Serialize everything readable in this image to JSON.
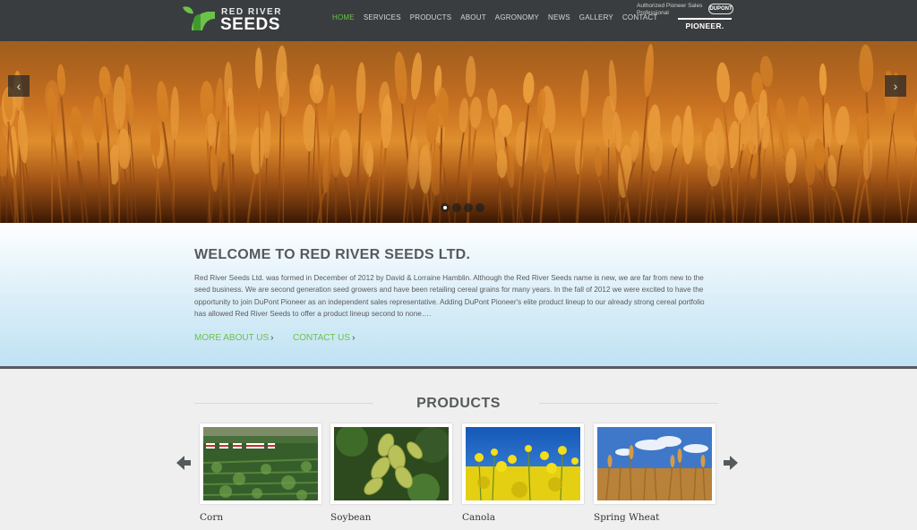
{
  "brand": {
    "line1": "RED RIVER",
    "line2": "SEEDS"
  },
  "nav": {
    "items": [
      "HOME",
      "SERVICES",
      "PRODUCTS",
      "ABOUT",
      "AGRONOMY",
      "NEWS",
      "GALLERY",
      "CONTACT"
    ],
    "active": "HOME"
  },
  "partner": {
    "text": "Authorized Pioneer Sales Professional",
    "dupont": "DUPONT",
    "pioneer": "PIONEER."
  },
  "hero": {
    "prev_icon": "chevron-left-icon",
    "next_icon": "chevron-right-icon",
    "slide_count": 4,
    "active_slide": 1
  },
  "welcome": {
    "title": "WELCOME TO RED RIVER SEEDS LTD.",
    "body": "Red River Seeds Ltd. was formed in December of 2012 by David & Lorraine Hamblin. Although the Red River Seeds name is new, we are far from new to the seed business. We are second generation seed growers and have been retailing cereal grains for many years. In the fall of 2012 we were excited to have the opportunity to join DuPont Pioneer as an independent sales representative. Adding DuPont Pioneer's elite product lineup to our already strong cereal portfolio has allowed Red River Seeds to offer a product lineup second to none….",
    "more_link": "MORE ABOUT US",
    "contact_link": "CONTACT US"
  },
  "products": {
    "title": "PRODUCTS",
    "prev_icon": "arrow-left-icon",
    "next_icon": "arrow-right-icon",
    "items": [
      {
        "label": "Corn"
      },
      {
        "label": "Soybean"
      },
      {
        "label": "Canola"
      },
      {
        "label": "Spring Wheat"
      }
    ]
  },
  "colors": {
    "header_bg": "#3a3d3f",
    "accent_green": "#6cc24a",
    "heading_gray": "#555a5c"
  }
}
